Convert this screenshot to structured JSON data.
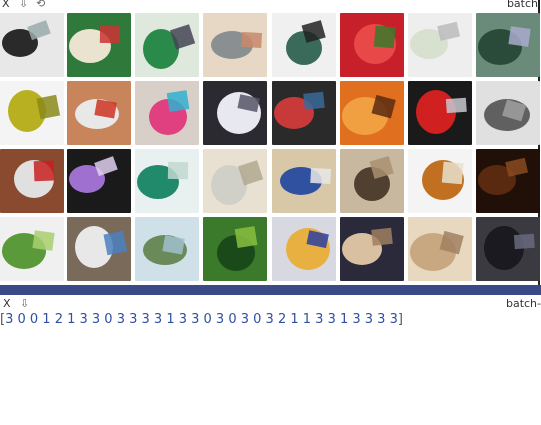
{
  "top_toolbar": {
    "close_label": "X",
    "download_icon": "download-arrow-icon",
    "undo_icon": "undo-icon",
    "title": "batch"
  },
  "bottom_toolbar": {
    "close_label": "X",
    "download_icon": "download-arrow-icon",
    "title": "batch-"
  },
  "image_grid": {
    "rows": 4,
    "cols": 8,
    "tiles": [
      {
        "desc": "dark object on white"
      },
      {
        "desc": "green printed package"
      },
      {
        "desc": "green printed leaf bag"
      },
      {
        "desc": "hand with metal bowl"
      },
      {
        "desc": "porcelain cup pattern"
      },
      {
        "desc": "red tomatoes"
      },
      {
        "desc": "white tape roll"
      },
      {
        "desc": "green wet object"
      },
      {
        "desc": "yellow-green box"
      },
      {
        "desc": "orange cardboard box"
      },
      {
        "desc": "colorful toys"
      },
      {
        "desc": "dark fabric"
      },
      {
        "desc": "tangled cables"
      },
      {
        "desc": "orange flowers"
      },
      {
        "desc": "red can in hand"
      },
      {
        "desc": "metal can"
      },
      {
        "desc": "red wrapper"
      },
      {
        "desc": "purple gear toy"
      },
      {
        "desc": "green tube"
      },
      {
        "desc": "clear plastic bottle"
      },
      {
        "desc": "blue toothpaste box"
      },
      {
        "desc": "metal cup"
      },
      {
        "desc": "chopsticks"
      },
      {
        "desc": "dark tea leaves"
      },
      {
        "desc": "cut melon"
      },
      {
        "desc": "power strip and cables"
      },
      {
        "desc": "plastic bottles"
      },
      {
        "desc": "watermelon"
      },
      {
        "desc": "plush bear toy"
      },
      {
        "desc": "open cardboard box"
      },
      {
        "desc": "cardboard box"
      },
      {
        "desc": "dark clothing"
      }
    ]
  },
  "labels_line": {
    "open_bracket": "[",
    "values": "3 0 0 1 2 1 3 3 0 3 3 3 3 1 3 3 0 3 0 3 0 3 2 1 1 3 3 1 3 3 3 3",
    "close_bracket": "]"
  },
  "colors": {
    "divider": "#3a4a86",
    "label_text": "#2f4fa0"
  }
}
